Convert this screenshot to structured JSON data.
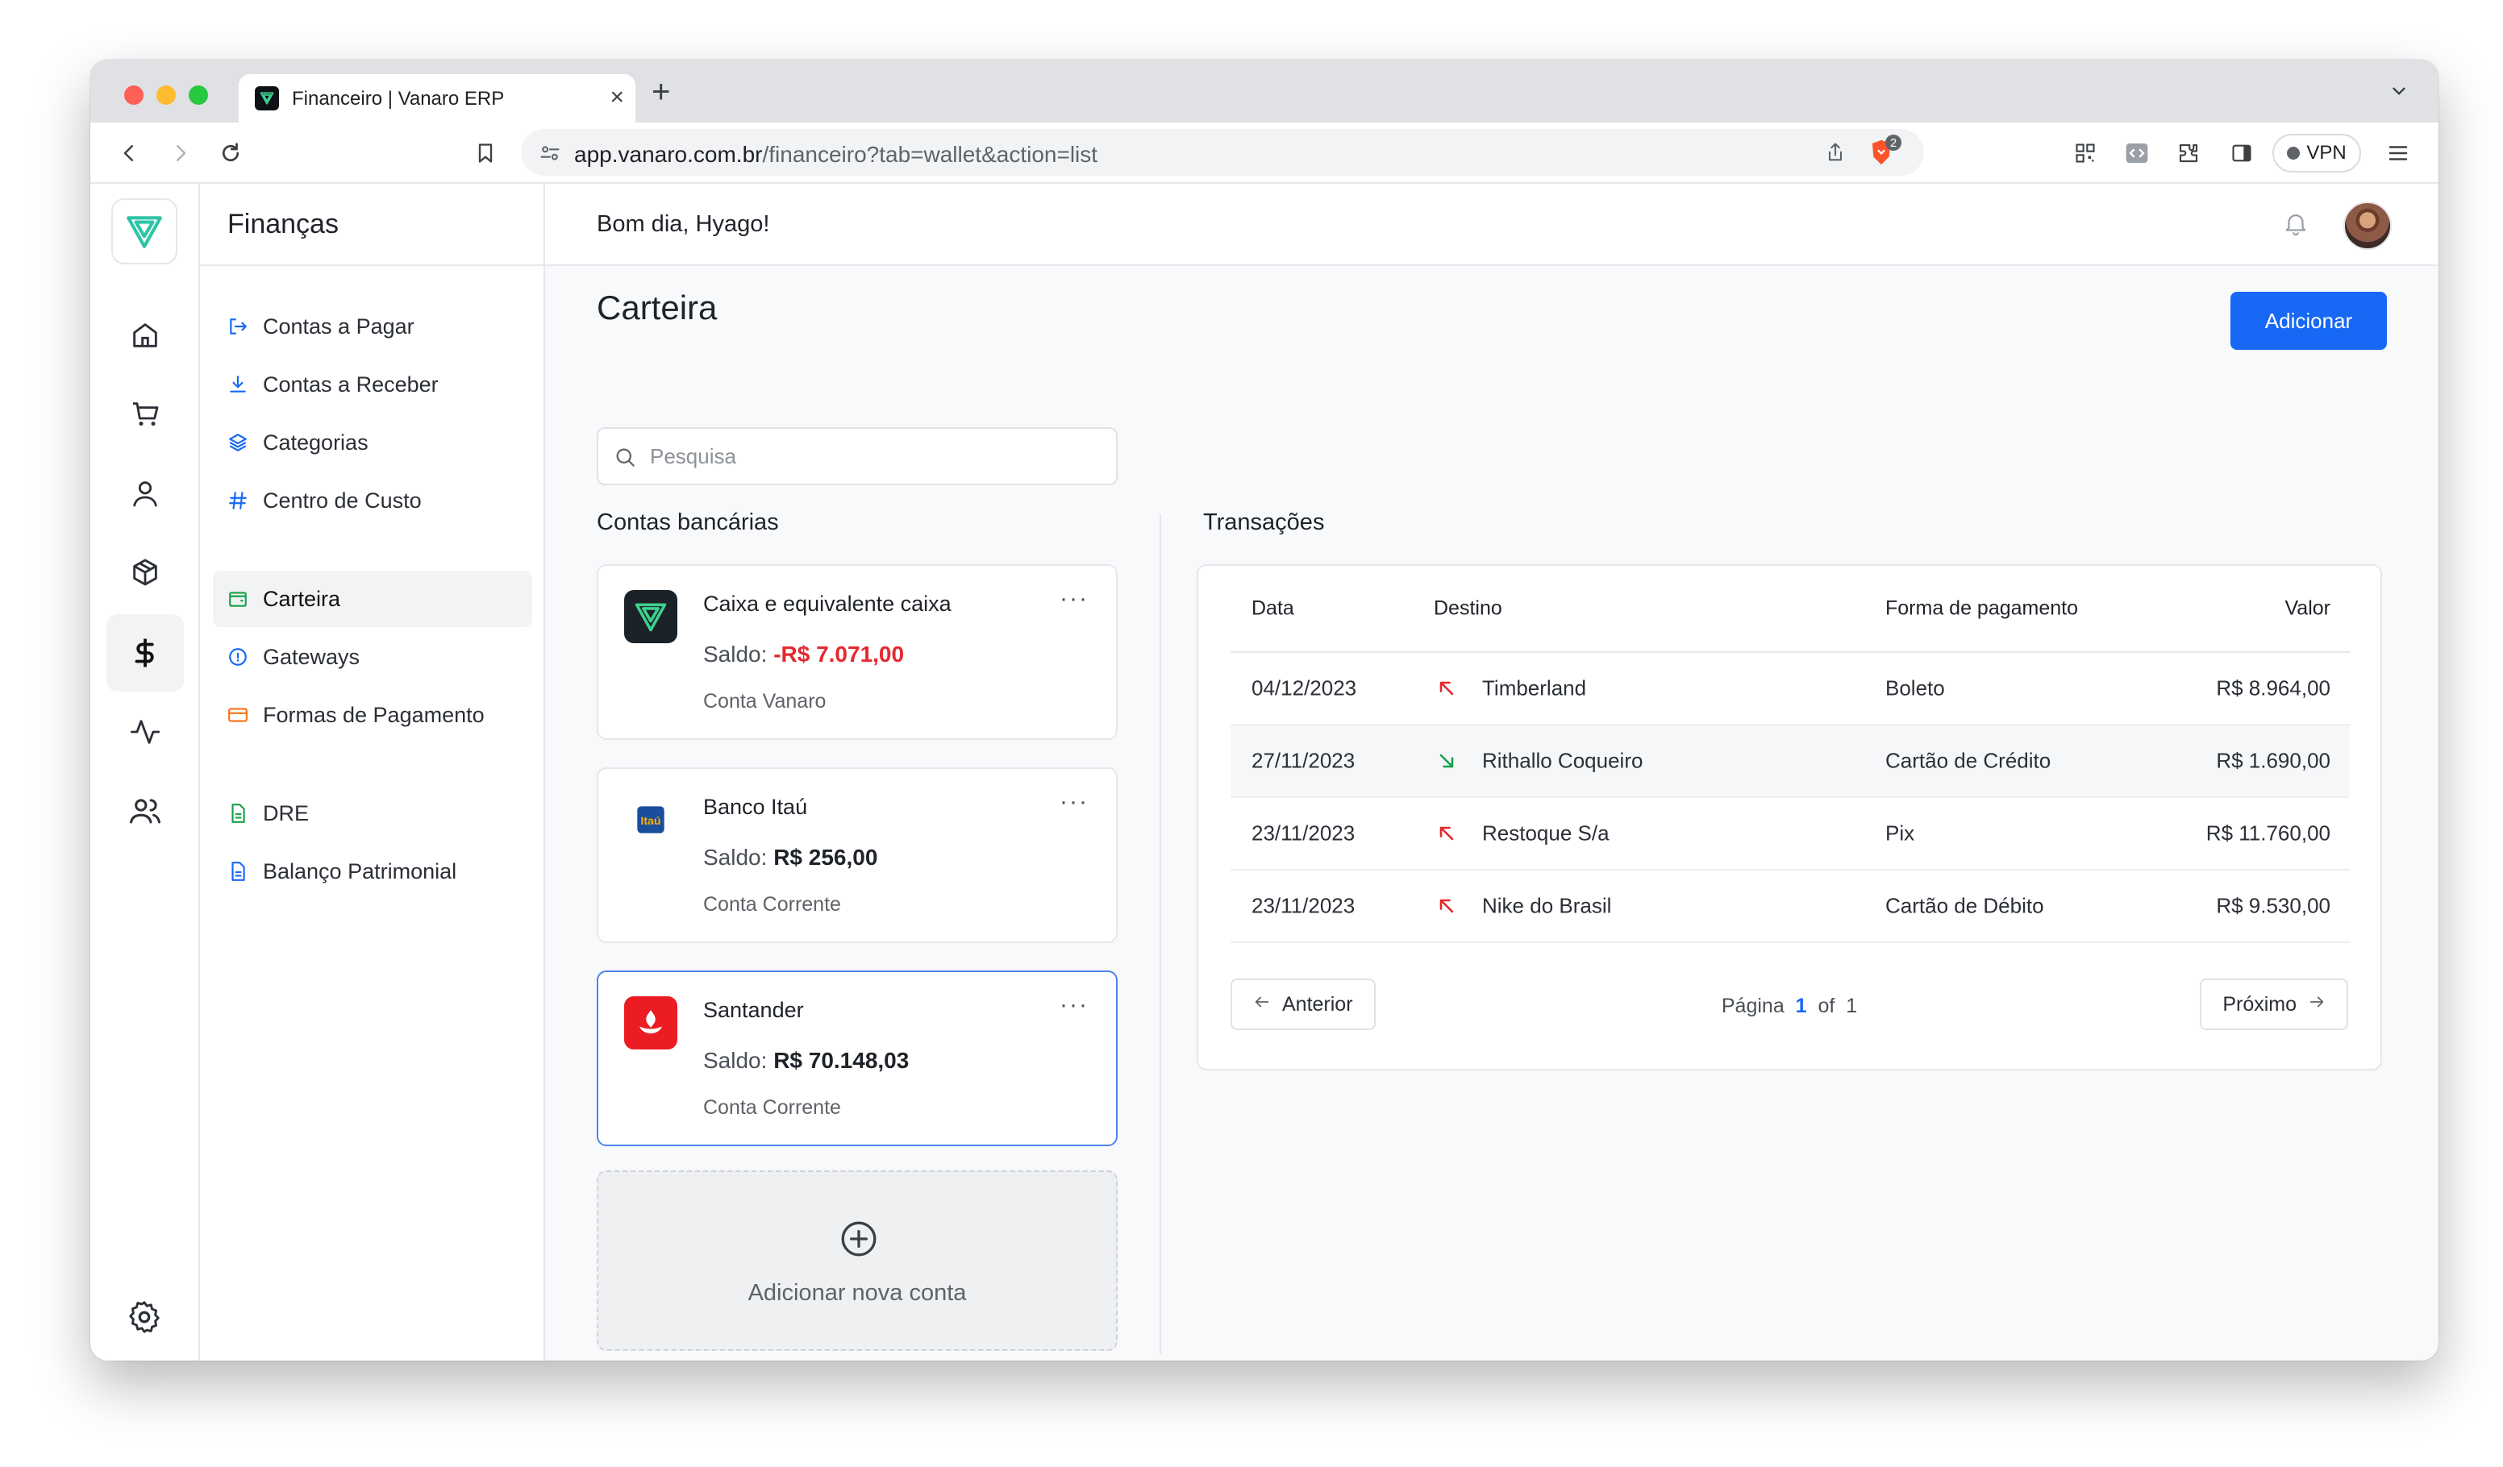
{
  "browser": {
    "tab_title": "Financeiro | Vanaro ERP",
    "url_host": "app.vanaro.com.br",
    "url_path": "/financeiro?tab=wallet&action=list",
    "shield_badge": "2",
    "vpn_label": "VPN"
  },
  "sidebar_rail": {
    "icons": [
      "home-icon",
      "cart-icon",
      "user-icon",
      "box-icon",
      "dollar-icon",
      "activity-icon",
      "users-icon",
      "gear-icon"
    ],
    "active": "dollar-icon"
  },
  "subnav": {
    "title": "Finanças",
    "items": [
      {
        "label": "Contas a Pagar",
        "icon": "logout-arrow-icon",
        "color": "#1668f5"
      },
      {
        "label": "Contas a Receber",
        "icon": "download-icon",
        "color": "#1668f5"
      },
      {
        "label": "Categorias",
        "icon": "layers-icon",
        "color": "#1668f5"
      },
      {
        "label": "Centro de Custo",
        "icon": "hash-icon",
        "color": "#1668f5"
      },
      {
        "label": "Carteira",
        "icon": "wallet-icon",
        "color": "#16a34a"
      },
      {
        "label": "Gateways",
        "icon": "info-circle-icon",
        "color": "#1668f5"
      },
      {
        "label": "Formas de Pagamento",
        "icon": "credit-card-icon",
        "color": "#f97316"
      },
      {
        "label": "DRE",
        "icon": "file-icon",
        "color": "#16a34a"
      },
      {
        "label": "Balanço Patrimonial",
        "icon": "file-icon",
        "color": "#1668f5"
      }
    ],
    "active": "Carteira"
  },
  "header": {
    "greeting": "Bom dia, Hyago!"
  },
  "page": {
    "title": "Carteira",
    "add_button": "Adicionar",
    "search_placeholder": "Pesquisa",
    "accounts_heading": "Contas bancárias",
    "transactions_heading": "Transações"
  },
  "accounts": [
    {
      "name": "Caixa e equivalente caixa",
      "saldo_label": "Saldo:",
      "saldo": "-R$ 7.071,00",
      "type": "Conta Vanaro",
      "logo": "vanaro-logo"
    },
    {
      "name": "Banco Itaú",
      "saldo_label": "Saldo:",
      "saldo": "R$ 256,00",
      "type": "Conta Corrente",
      "logo": "itau-logo"
    },
    {
      "name": "Santander",
      "saldo_label": "Saldo:",
      "saldo": "R$ 70.148,03",
      "type": "Conta Corrente",
      "logo": "santander-logo"
    }
  ],
  "add_account_label": "Adicionar nova conta",
  "transactions": {
    "columns": [
      "Data",
      "Destino",
      "Forma de pagamento",
      "Valor"
    ],
    "rows": [
      {
        "date": "04/12/2023",
        "direction": "out",
        "dest": "Timberland",
        "payment": "Boleto",
        "value": "R$ 8.964,00"
      },
      {
        "date": "27/11/2023",
        "direction": "in",
        "dest": "Rithallo Coqueiro",
        "payment": "Cartão de Crédito",
        "value": "R$ 1.690,00"
      },
      {
        "date": "23/11/2023",
        "direction": "out",
        "dest": "Restoque S/a",
        "payment": "Pix",
        "value": "R$ 11.760,00"
      },
      {
        "date": "23/11/2023",
        "direction": "out",
        "dest": "Nike do Brasil",
        "payment": "Cartão de Débito",
        "value": "R$ 9.530,00"
      }
    ],
    "pagination": {
      "prev": "Anterior",
      "next": "Próximo",
      "page_label": "Página",
      "current": "1",
      "of_label": "of",
      "total": "1"
    }
  },
  "colors": {
    "primary": "#1668f5",
    "negative": "#e5282d",
    "positive": "#16a34a",
    "out_arrow": "#e5282d"
  }
}
